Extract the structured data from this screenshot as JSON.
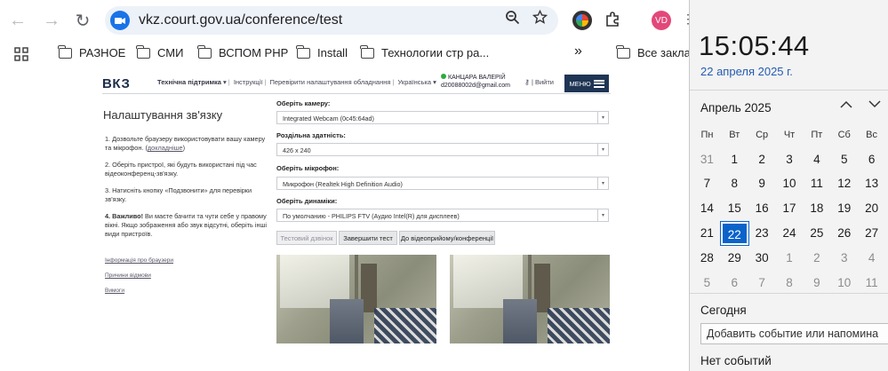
{
  "browser": {
    "url": "vkz.court.gov.ua/conference/test",
    "avatar_initials": "VD",
    "bookmarks": [
      "РАЗНОЕ",
      "СМИ",
      "ВСПОМ PHP",
      "Install",
      "Технологии стр ра...",
      "Все заклад"
    ],
    "more_glyph": "»"
  },
  "site": {
    "logo": "ВКЗ",
    "nav": {
      "support": "Технічна підтримка",
      "instructions": "Інструкції",
      "check_settings": "Перевірити налаштування обладнання",
      "language": "Українська"
    },
    "user_name": "КАНЦАРА ВАЛЕРІЙ",
    "user_email": "d20088002d@gmail.com",
    "logout": "Вийти",
    "menu": "МЕНЮ"
  },
  "settings": {
    "title": "Налаштування зв'язку",
    "steps": {
      "s1": "1. Дозвольте браузеру використовувати вашу камеру та мікрофон. (",
      "s1_link": "докладніше",
      "s1_end": ")",
      "s2": "2. Оберіть пристрої, які будуть використані під час відеоконференц-зв'язку.",
      "s3": "3. Натисніть кнопку «Подзвонити» для перевірки зв'язку.",
      "s4_bold": "4. Важливо!",
      "s4": " Ви маєте бачити та чути себе у правому вікні. Якщо зображення або звук відсутні, оберіть інші види пристроїв."
    },
    "side_links": [
      "Інформація про браузери",
      "Причини відмови",
      "Вимоги"
    ],
    "camera_label": "Оберіть камеру:",
    "camera_value": "Integrated Webcam (0c45:64ad)",
    "resolution_label": "Роздільна здатність:",
    "resolution_value": "426 x 240",
    "mic_label": "Оберіть мікрофон:",
    "mic_value": "Микрофон (Realtek High Definition Audio)",
    "speaker_label": "Оберіть динаміки:",
    "speaker_value": "По умолчанию - PHILIPS FTV (Аудио Intel(R) для дисплеев)",
    "buttons": {
      "test_call": "Тестовий дзвінок",
      "end_test": "Завершити тест",
      "to_room": "До відеоприйому/конференції"
    }
  },
  "flyout": {
    "time": "15:05:44",
    "date_long": "22 апреля 2025 г.",
    "month": "Апрель 2025",
    "weekdays": [
      "Пн",
      "Вт",
      "Ср",
      "Чт",
      "Пт",
      "Сб",
      "Вс"
    ],
    "weeks": [
      [
        "31",
        "1",
        "2",
        "3",
        "4",
        "5",
        "6"
      ],
      [
        "7",
        "8",
        "9",
        "10",
        "11",
        "12",
        "13"
      ],
      [
        "14",
        "15",
        "16",
        "17",
        "18",
        "19",
        "20"
      ],
      [
        "21",
        "22",
        "23",
        "24",
        "25",
        "26",
        "27"
      ],
      [
        "28",
        "29",
        "30",
        "1",
        "2",
        "3",
        "4"
      ],
      [
        "5",
        "6",
        "7",
        "8",
        "9",
        "10",
        "11"
      ]
    ],
    "today_label": "Сегодня",
    "add_event": "Добавить событие или напомина",
    "no_events": "Нет событий"
  }
}
